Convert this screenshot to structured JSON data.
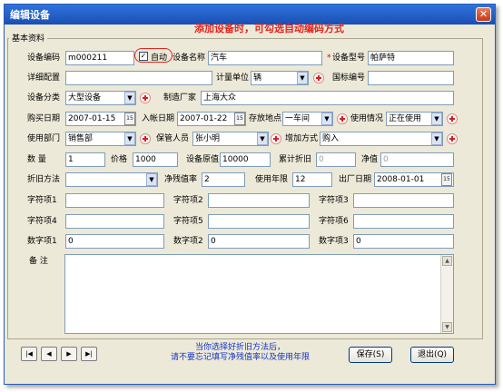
{
  "window": {
    "title": "编辑设备",
    "close_glyph": "✕"
  },
  "annotation": "添加设备时，可勾选自动编码方式",
  "group_title": "基本资料",
  "fields": {
    "device_code": {
      "label": "设备编码",
      "value": "m000211"
    },
    "auto_code": {
      "label": "自动",
      "checked": true
    },
    "device_name": {
      "label": "设备名称",
      "value": "汽车"
    },
    "device_model": {
      "label": "设备型号",
      "value": "帕萨特",
      "required_mark": "*"
    },
    "detail_config": {
      "label": "详细配置",
      "value": ""
    },
    "unit": {
      "label": "计量单位",
      "value": "辆"
    },
    "intl_code": {
      "label": "国标编号",
      "value": ""
    },
    "category": {
      "label": "设备分类",
      "value": "大型设备"
    },
    "manufacturer": {
      "label": "制造厂家",
      "value": "上海大众"
    },
    "purchase_date": {
      "label": "购买日期",
      "value": "2007-01-15"
    },
    "entry_date": {
      "label": "入帐日期",
      "value": "2007-01-22"
    },
    "location": {
      "label": "存放地点",
      "value": "一车间"
    },
    "status": {
      "label": "使用情况",
      "value": "正在使用"
    },
    "department": {
      "label": "使用部门",
      "value": "销售部"
    },
    "keeper": {
      "label": "保管人员",
      "value": "张小明"
    },
    "add_method": {
      "label": "增加方式",
      "value": "购入"
    },
    "quantity": {
      "label": "数  量",
      "value": "1"
    },
    "price": {
      "label": "价格",
      "value": "1000"
    },
    "original_value": {
      "label": "设备原值",
      "value": "10000"
    },
    "accum_depr": {
      "label": "累计折旧",
      "value": "0"
    },
    "net_value": {
      "label": "净值",
      "value": "0"
    },
    "depr_method": {
      "label": "折旧方法",
      "value": ""
    },
    "residual_rate": {
      "label": "净残值率",
      "value": "2"
    },
    "life_years": {
      "label": "使用年限",
      "value": "12"
    },
    "factory_date": {
      "label": "出厂日期",
      "value": "2008-01-01"
    },
    "str1": {
      "label": "字符项1",
      "value": ""
    },
    "str2": {
      "label": "字符项2",
      "value": ""
    },
    "str3": {
      "label": "字符项3",
      "value": ""
    },
    "str4": {
      "label": "字符项4",
      "value": ""
    },
    "str5": {
      "label": "字符项5",
      "value": ""
    },
    "str6": {
      "label": "字符项6",
      "value": ""
    },
    "num1": {
      "label": "数字项1",
      "value": "0"
    },
    "num2": {
      "label": "数字项2",
      "value": "0"
    },
    "num3": {
      "label": "数字项3",
      "value": "0"
    },
    "notes": {
      "label": "备  注",
      "value": ""
    }
  },
  "icons": {
    "calendar": "15",
    "dropdown": "▼",
    "scroll_up": "▲",
    "scroll_down": "▼"
  },
  "nav": {
    "first": "|◀",
    "prev": "◀",
    "next": "▶",
    "last": "▶|"
  },
  "hint": {
    "line1": "当你选择好折旧方法后，",
    "line2": "请不要忘记填写净残值率以及使用年限"
  },
  "buttons": {
    "save": "保存(S)",
    "exit": "退出(Q)"
  },
  "colors": {
    "annotation": "#e2261e",
    "hint": "#1533c8",
    "titlebar": "#1a4fb3"
  }
}
